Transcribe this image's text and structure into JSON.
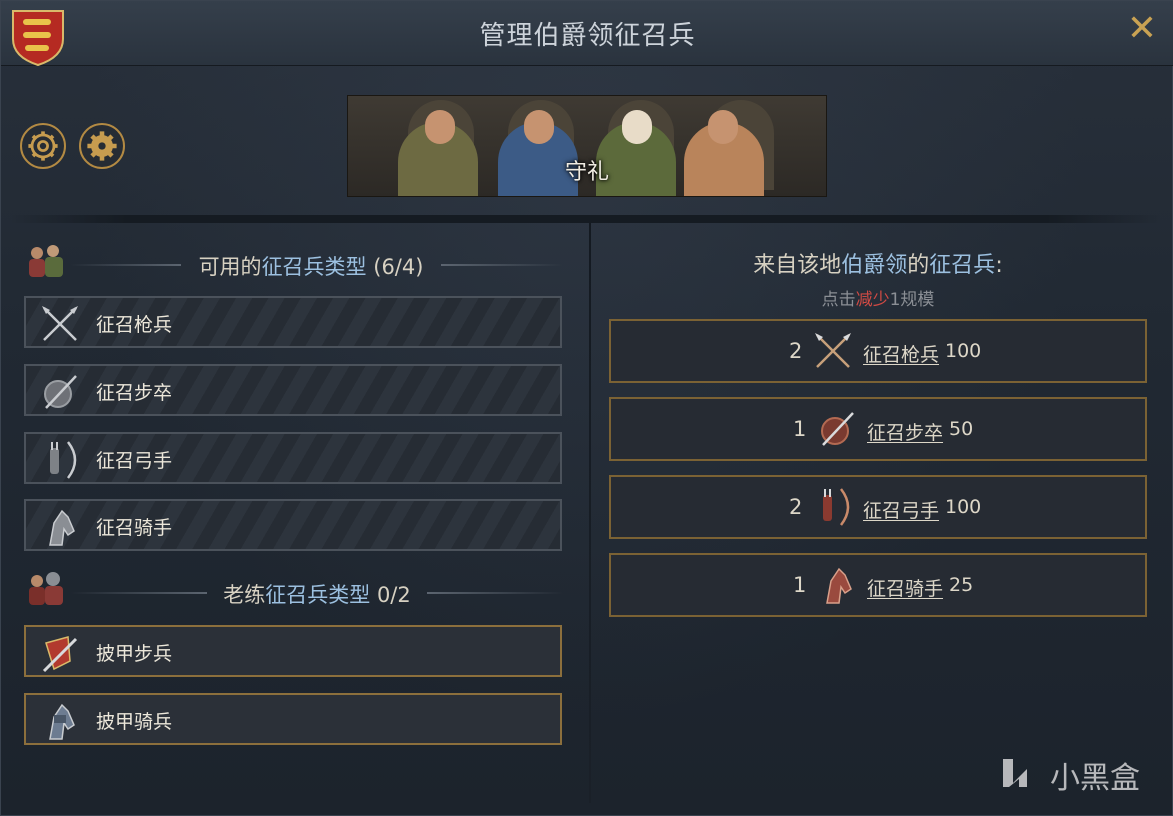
{
  "window": {
    "title": "管理伯爵领征召兵",
    "close_label": "✕"
  },
  "banner": {
    "label": "守礼"
  },
  "left": {
    "available_header": {
      "prefix": "可用的",
      "highlight": "征召兵类型",
      "count": "(6/4)"
    },
    "available_units": [
      {
        "label": "征召枪兵",
        "icon": "crossed-polearms-icon"
      },
      {
        "label": "征召步卒",
        "icon": "shield-spear-icon"
      },
      {
        "label": "征召弓手",
        "icon": "bow-quiver-icon"
      },
      {
        "label": "征召骑手",
        "icon": "horse-head-icon"
      }
    ],
    "veteran_header": {
      "prefix": "老练",
      "highlight": "征召兵类型",
      "count": "0/2"
    },
    "veteran_units": [
      {
        "label": "披甲步兵",
        "icon": "sword-shield-icon"
      },
      {
        "label": "披甲骑兵",
        "icon": "armored-horse-icon"
      }
    ]
  },
  "right": {
    "header": {
      "prefix": "来自该地",
      "highlight": "伯爵领",
      "middle": "的",
      "highlight2": "征召兵",
      "suffix": ":"
    },
    "hint": {
      "prefix": "点击",
      "red": "减少",
      "suffix": "1规模"
    },
    "levies": [
      {
        "count": "2",
        "name": "征召枪兵",
        "size": "100",
        "icon": "crossed-polearms-red-icon"
      },
      {
        "count": "1",
        "name": "征召步卒",
        "size": "50",
        "icon": "shield-spear-red-icon"
      },
      {
        "count": "2",
        "name": "征召弓手",
        "size": "100",
        "icon": "bow-quiver-red-icon"
      },
      {
        "count": "1",
        "name": "征召骑手",
        "size": "25",
        "icon": "horse-head-red-icon"
      }
    ]
  },
  "watermark": "小黑盒",
  "colors": {
    "gold": "#b38a43",
    "blue_highlight": "#9cc0e0",
    "red_highlight": "#d04a44"
  }
}
